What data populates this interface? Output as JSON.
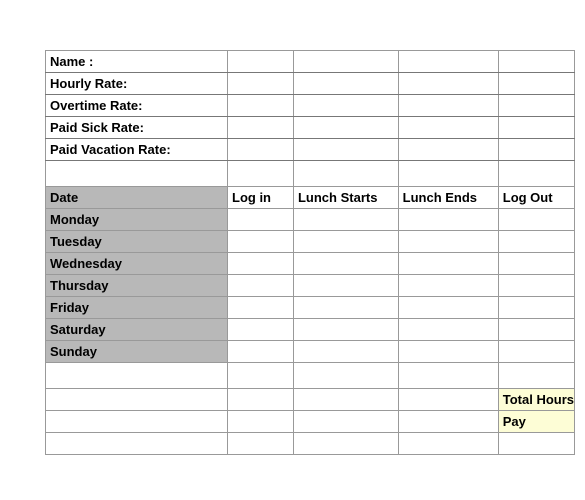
{
  "info": {
    "name_label": "Name :",
    "hourly_rate_label": "Hourly Rate:",
    "overtime_rate_label": "Overtime Rate:",
    "paid_sick_rate_label": "Paid Sick Rate:",
    "paid_vacation_rate_label": "Paid Vacation Rate:",
    "name_value": "",
    "hourly_rate_value": "",
    "overtime_rate_value": "",
    "paid_sick_rate_value": "",
    "paid_vacation_rate_value": ""
  },
  "headers": {
    "date": "Date",
    "log_in": "Log in",
    "lunch_starts": "Lunch Starts",
    "lunch_ends": "Lunch Ends",
    "log_out": "Log Out"
  },
  "days": [
    {
      "name": "Monday",
      "log_in": "",
      "lunch_starts": "",
      "lunch_ends": "",
      "log_out": ""
    },
    {
      "name": "Tuesday",
      "log_in": "",
      "lunch_starts": "",
      "lunch_ends": "",
      "log_out": ""
    },
    {
      "name": "Wednesday",
      "log_in": "",
      "lunch_starts": "",
      "lunch_ends": "",
      "log_out": ""
    },
    {
      "name": "Thursday",
      "log_in": "",
      "lunch_starts": "",
      "lunch_ends": "",
      "log_out": ""
    },
    {
      "name": "Friday",
      "log_in": "",
      "lunch_starts": "",
      "lunch_ends": "",
      "log_out": ""
    },
    {
      "name": "Saturday",
      "log_in": "",
      "lunch_starts": "",
      "lunch_ends": "",
      "log_out": ""
    },
    {
      "name": "Sunday",
      "log_in": "",
      "lunch_starts": "",
      "lunch_ends": "",
      "log_out": ""
    }
  ],
  "totals": {
    "total_hours_label": "Total Hours",
    "total_hours_value": "",
    "pay_label": "Pay",
    "pay_value": ""
  }
}
